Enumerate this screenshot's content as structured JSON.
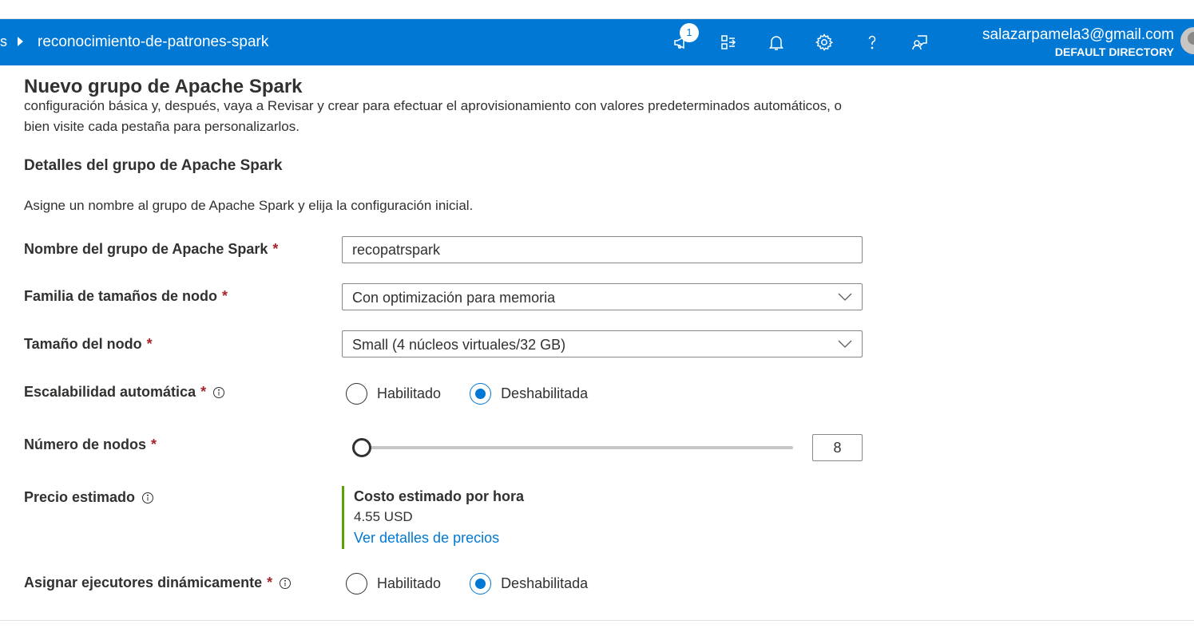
{
  "topbar": {
    "breadcrumb_fragment": "s",
    "breadcrumb_title": "reconocimiento-de-patrones-spark",
    "notification_count": "1",
    "icons": [
      "announcement-icon",
      "directory-switch-icon",
      "bell-icon",
      "gear-icon",
      "help-icon",
      "feedback-icon"
    ],
    "account_email": "salazarpamela3@gmail.com",
    "account_directory": "DEFAULT DIRECTORY",
    "bar_color": "#0078d4"
  },
  "page": {
    "title": "Nuevo grupo de Apache Spark",
    "intro": "configuración básica y, después, vaya a Revisar y crear para efectuar el aprovisionamiento con valores predeterminados automáticos, o bien visite cada pestaña para personalizarlos.",
    "section_heading": "Detalles del grupo de Apache Spark",
    "section_desc": "Asigne un nombre al grupo de Apache Spark y elija la configuración inicial."
  },
  "form": {
    "required_mark": "*",
    "pool_name": {
      "label": "Nombre del grupo de Apache Spark",
      "value": "recopatrspark"
    },
    "node_family": {
      "label": "Familia de tamaños de nodo",
      "selected": "Con optimización para memoria"
    },
    "node_size": {
      "label": "Tamaño del nodo",
      "selected": "Small (4 núcleos virtuales/32 GB)"
    },
    "autoscale": {
      "label": "Escalabilidad automática",
      "option_on": "Habilitado",
      "option_off": "Deshabilitada",
      "selected": "Deshabilitada"
    },
    "node_count": {
      "label": "Número de nodos",
      "value": "8",
      "slider_fraction": 0.0
    },
    "price": {
      "label": "Precio estimado",
      "title": "Costo estimado por hora",
      "value": "4.55 USD",
      "link": "Ver detalles de precios",
      "accent": "#57a300"
    },
    "dynamic_executors": {
      "label": "Asignar ejecutores dinámicamente",
      "option_on": "Habilitado",
      "option_off": "Deshabilitada",
      "selected": "Deshabilitada"
    }
  }
}
